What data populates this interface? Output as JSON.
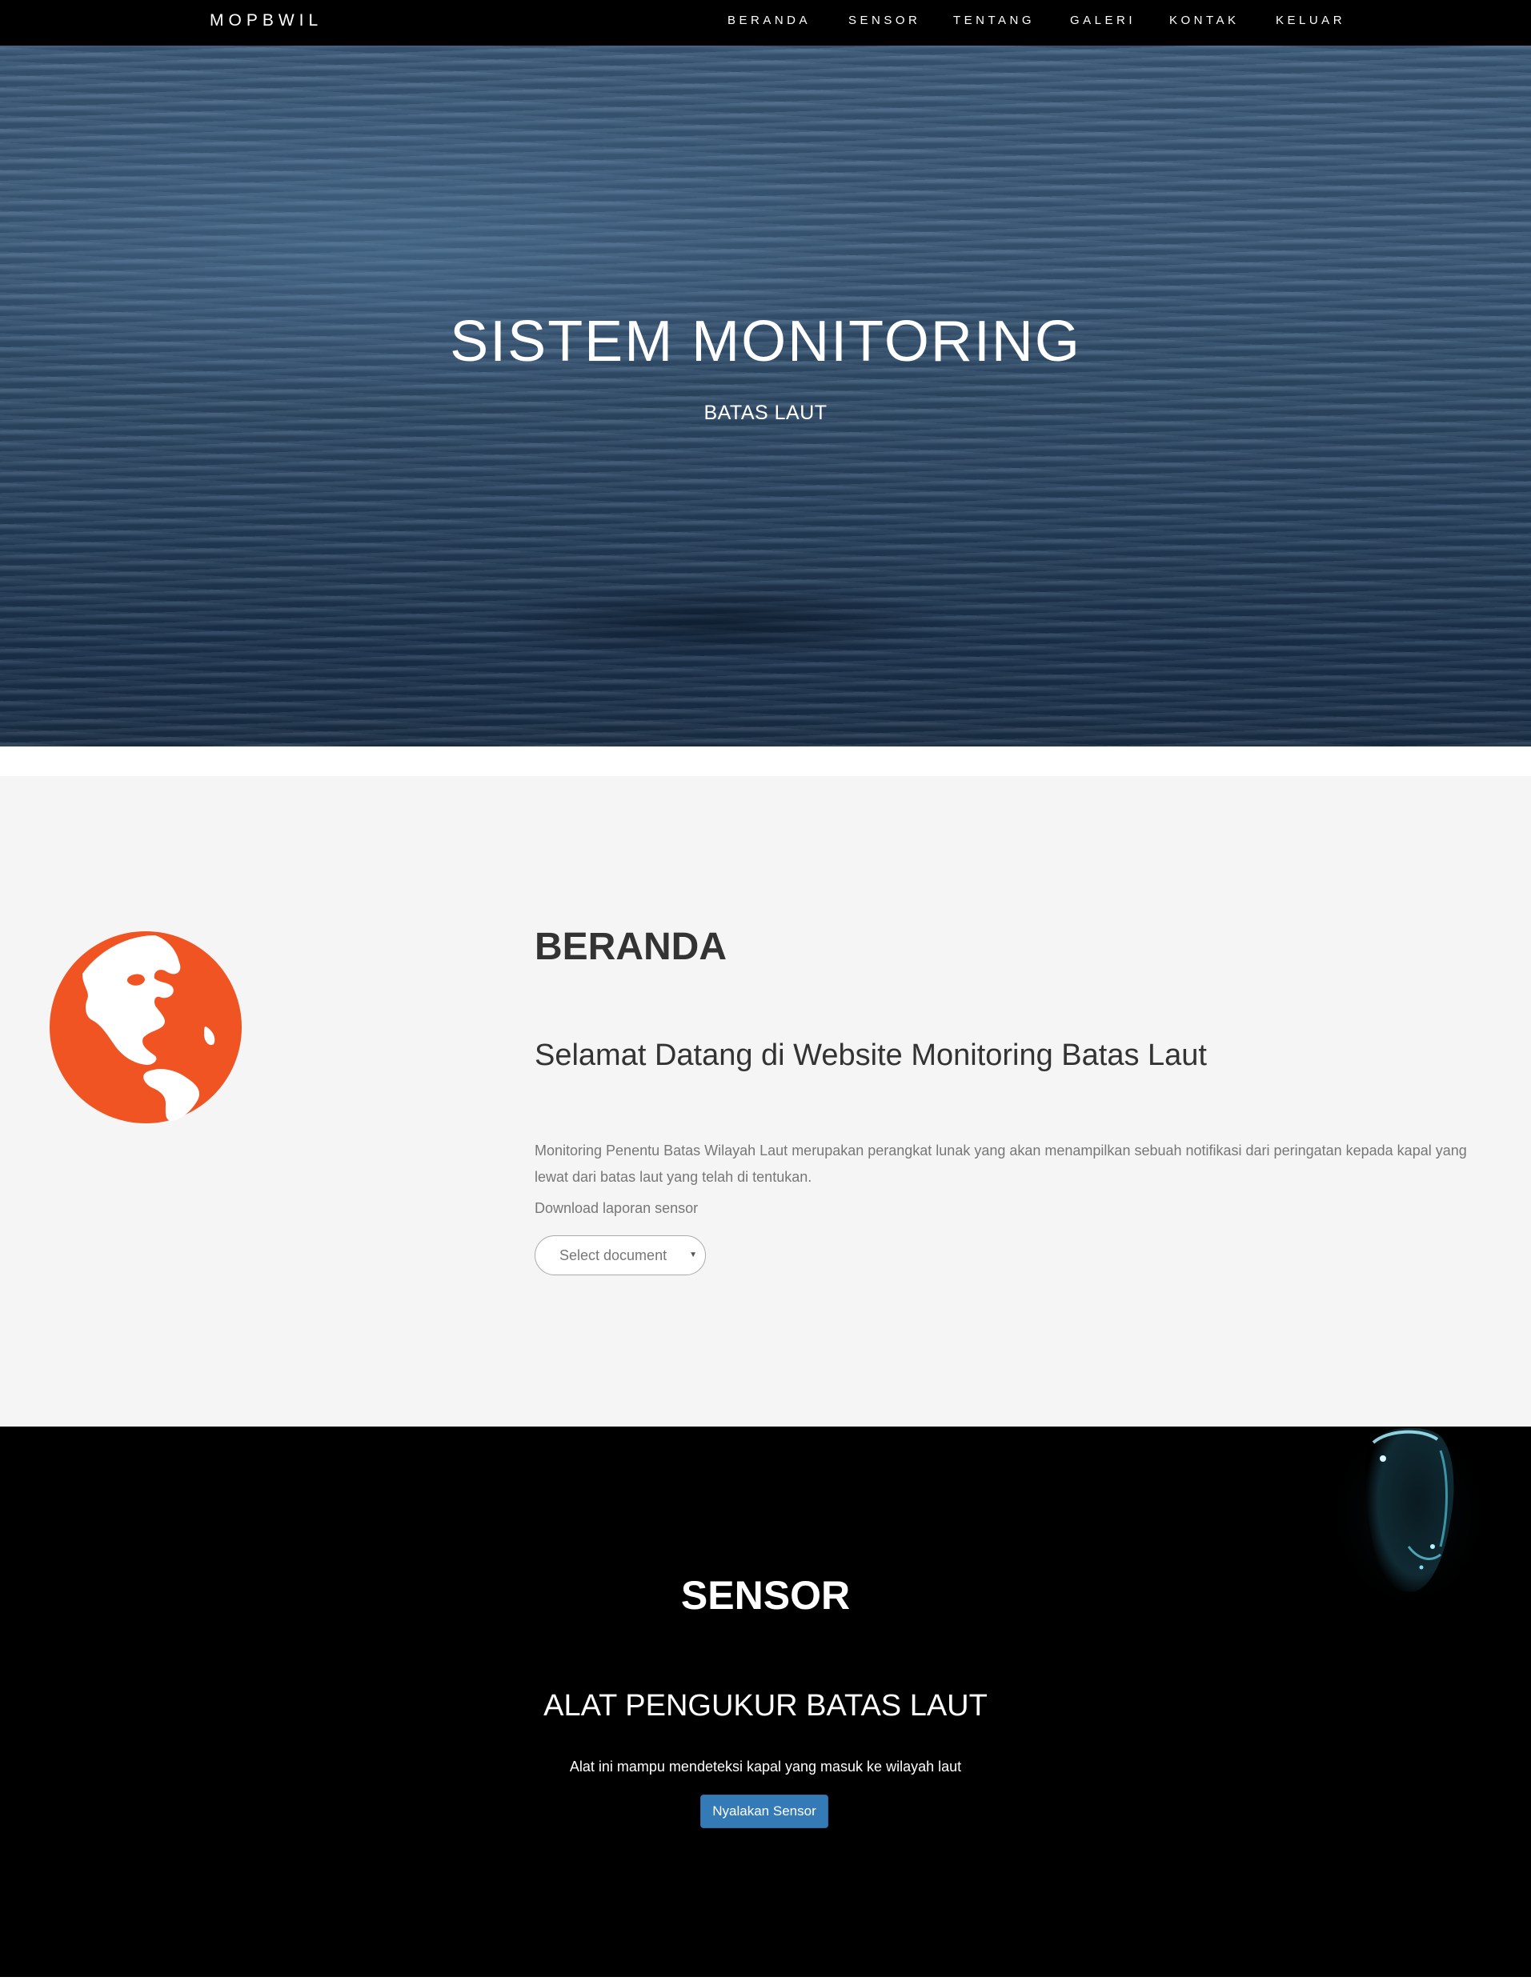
{
  "navbar": {
    "brand": "MOPBWIL",
    "links": [
      "BERANDA",
      "SENSOR",
      "TENTANG",
      "GALERI",
      "KONTAK",
      "KELUAR"
    ]
  },
  "hero": {
    "title": "SISTEM MONITORING",
    "subtitle": "BATAS LAUT"
  },
  "beranda": {
    "icon": "globe-icon",
    "icon_color": "#f05423",
    "heading": "BERANDA",
    "welcome": "Selamat Datang di Website Monitoring Batas Laut",
    "description": "Monitoring Penentu Batas Wilayah Laut merupakan perangkat lunak yang akan menampilkan sebuah notifikasi dari peringatan kepada kapal yang lewat dari batas laut yang telah di tentukan.",
    "download_label": "Download laporan sensor",
    "select_placeholder": "Select document"
  },
  "sensor": {
    "heading": "SENSOR",
    "subheading": "ALAT PENGUKUR BATAS LAUT",
    "description": "Alat ini mampu mendeteksi kapal yang masuk ke wilayah laut",
    "button_label": "Nyalakan Sensor",
    "button_color": "#337ab7"
  }
}
